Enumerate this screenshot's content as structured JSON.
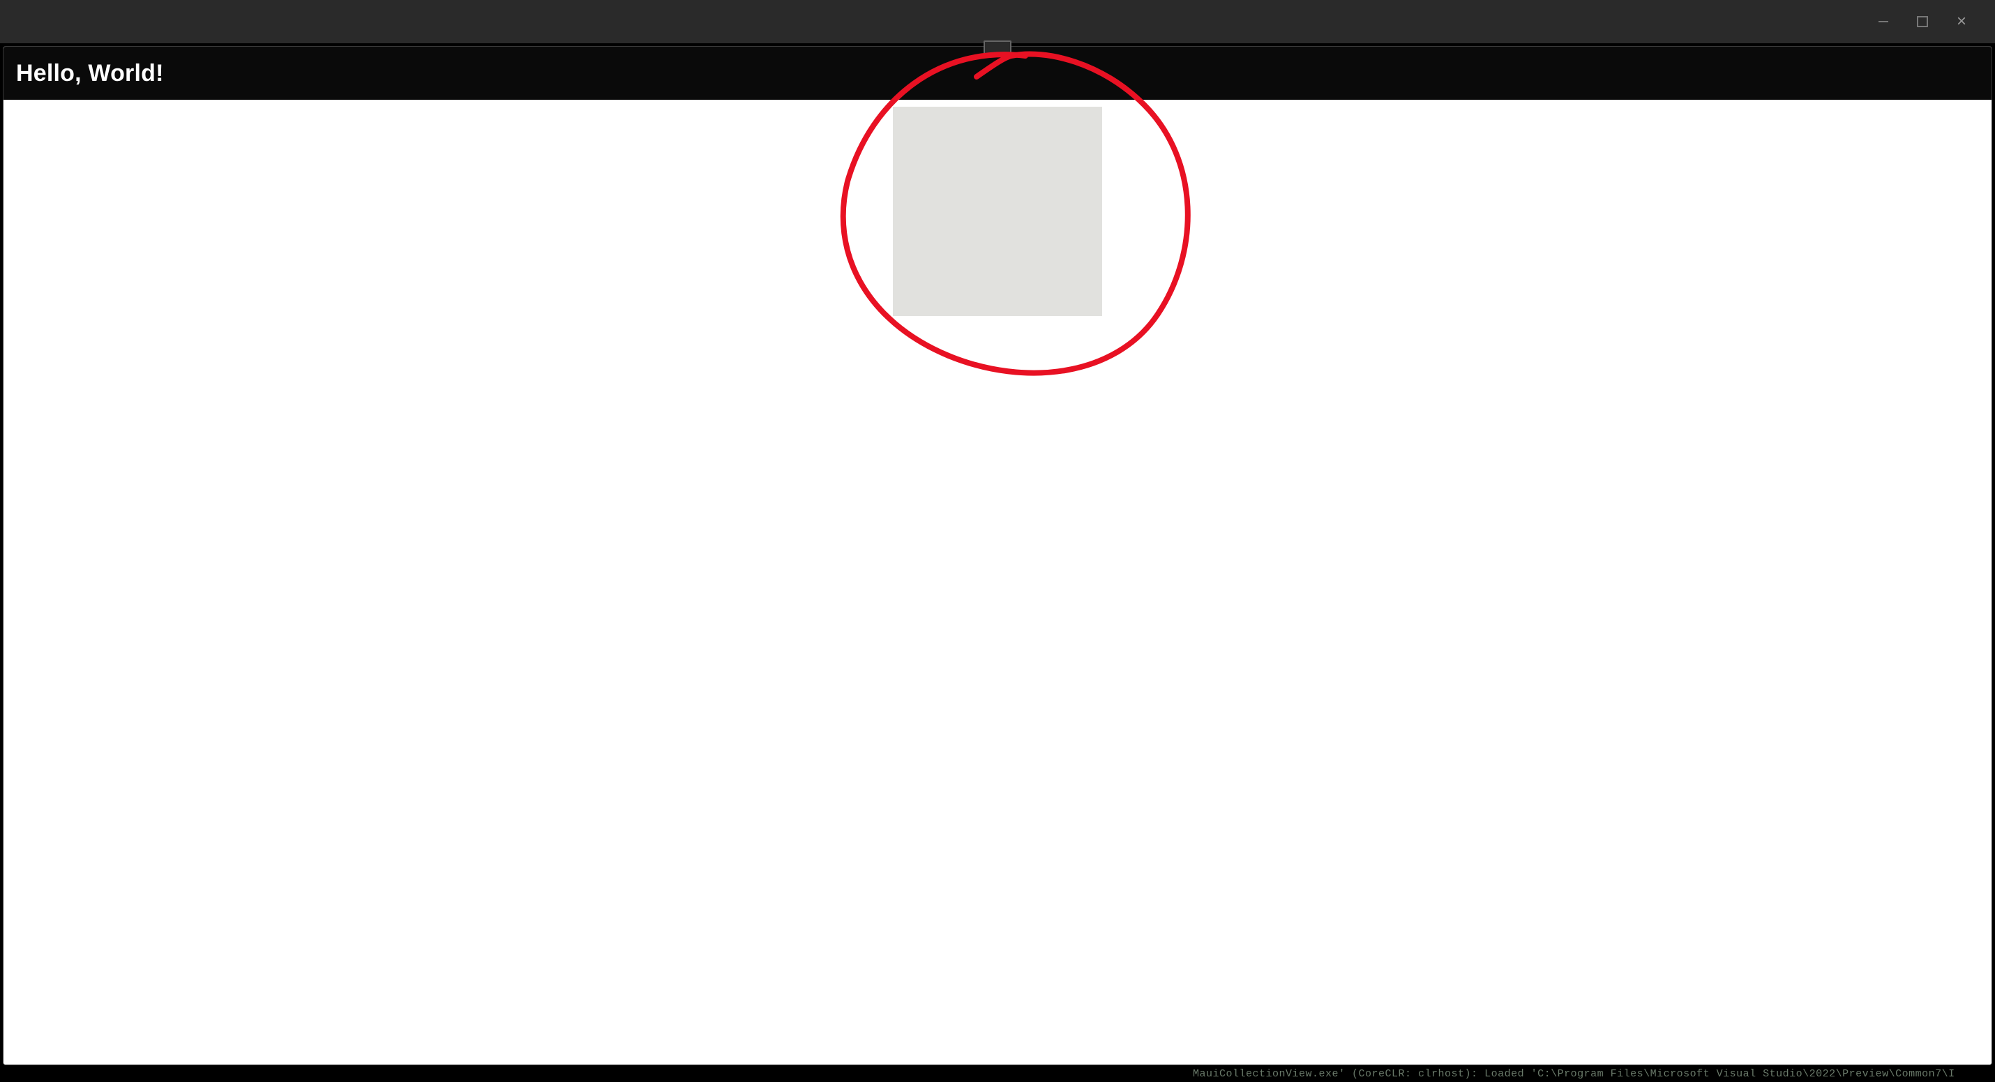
{
  "window": {
    "controls": {
      "minimize": "–",
      "maximize": "☐",
      "close": "×"
    }
  },
  "app": {
    "title": "Hello, World!"
  },
  "content": {
    "placeholder": ""
  },
  "annotation": {
    "color": "#e81123",
    "stroke_width": 8
  },
  "statusbar": {
    "text": "MauiCollectionView.exe' (CoreCLR: clrhost): Loaded 'C:\\Program Files\\Microsoft Visual Studio\\2022\\Preview\\Common7\\I"
  }
}
